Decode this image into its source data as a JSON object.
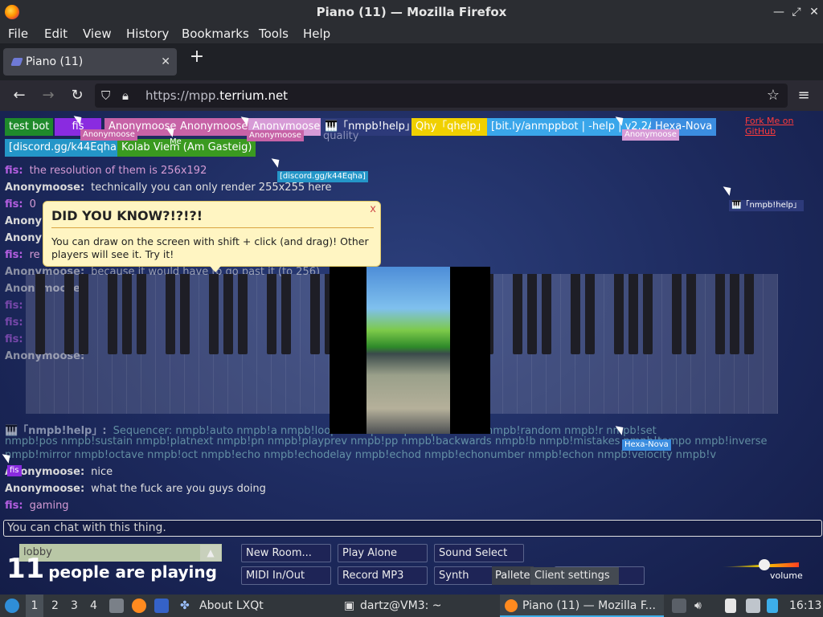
{
  "window": {
    "title": "Piano (11) — Mozilla Firefox"
  },
  "menu": [
    "File",
    "Edit",
    "View",
    "History",
    "Bookmarks",
    "Tools",
    "Help"
  ],
  "tab": {
    "label": "Piano (11)"
  },
  "nav": {
    "url_prefix": "https://mpp.",
    "url_domain": "terrium.net"
  },
  "page": {
    "users": [
      {
        "name": "test bot",
        "color": "#1f8a2b"
      },
      {
        "name": "fis",
        "color": "#8a2be0"
      },
      {
        "name": "Anonymoose",
        "color": "#c763a7"
      },
      {
        "name": "Anonymoose",
        "color": "#c763a7"
      },
      {
        "name": "Anonymoose",
        "color": "#d79bd7"
      },
      {
        "name": "🎹「nmpb!help」",
        "color": "#2d3a7a"
      },
      {
        "name": "Qhy「qhelp」",
        "color": "#f0d000"
      },
      {
        "name": "[bit.ly/anmppbot | -help | v2.2A]",
        "color": "#3aa6ea"
      },
      {
        "name": "Hexa-Nova",
        "color": "#3b8de0"
      },
      {
        "name": "[discord.gg/k44Eqha]",
        "color": "#2496c8"
      },
      {
        "name": "Kolab Viem (Am Gasteig)",
        "color": "#3a9a20"
      }
    ],
    "fork_link": "Fork Me on GitHub",
    "chat": [
      {
        "name": "fis:",
        "text": "the resolution of them is 256x192",
        "kind": "fis"
      },
      {
        "name": "Anonymoose:",
        "text": "technically you can only render 255x255 here",
        "kind": "anon"
      },
      {
        "name": "fis:",
        "text": "0",
        "kind": "fis"
      },
      {
        "name": "Anonymoose:",
        "text": "",
        "kind": "anon"
      },
      {
        "name": "Anonymoose:",
        "text": "",
        "kind": "anon"
      },
      {
        "name": "fis:",
        "text": "re",
        "kind": "fis"
      },
      {
        "name": "Anonymoose:",
        "text": "because it would have to go past it (to 256)",
        "kind": "anon"
      },
      {
        "name": "Anonymoose:",
        "text": "",
        "kind": "anon"
      },
      {
        "name": "fis:",
        "text": "",
        "kind": "fis"
      },
      {
        "name": "fis:",
        "text": "",
        "kind": "fis"
      },
      {
        "name": "fis:",
        "text": "",
        "kind": "fis"
      },
      {
        "name": "Anonymoose:",
        "text": "",
        "kind": "anon"
      }
    ],
    "bot_lines": [
      {
        "name": "🎹「nmpb!help」:",
        "text": "Sequencer: nmpb!auto nmpb!a nmpb!loop ... nmpb!stop nmpb!restart nmpb!random nmpb!r nmpb!set"
      },
      {
        "text": "nmpb!pos nmpb!sustain nmpb!platnext nmpb!pn nmpb!playprev nmpb!pp nmpb!backwards nmpb!b nmpb!mistakes nmpb!tempo nmpb!inverse"
      },
      {
        "text": "nmpb!mirror nmpb!octave nmpb!oct nmpb!echo nmpb!echodelay nmpb!echod nmpb!echonumber nmpb!echon nmpb!velocity nmpb!v"
      }
    ],
    "recent_chat": [
      {
        "name": "Anonymoose:",
        "text": "nice",
        "kind": "anon"
      },
      {
        "name": "Anonymoose:",
        "text": "what the fuck are you guys doing",
        "kind": "anon"
      },
      {
        "name": "fis:",
        "text": "gaming",
        "kind": "fis"
      }
    ],
    "partial_text": "quality",
    "tooltip": {
      "title": "DID YOU KNOW?!?!?!",
      "body": "You can draw on the screen with shift + click (and drag)! Other players will see it. Try it!",
      "close": "x"
    },
    "cursor_labels": {
      "anon1": "Anonymoose",
      "me": "Me",
      "anon2": "Anonymoose",
      "anon3": "Anonymoose",
      "discord": "[discord.gg/k44Eqha]",
      "nmpb": "🎹「nmpb!help」",
      "hexa": "Hexa-Nova",
      "fis": "fis"
    },
    "chat_placeholder": "You can chat with this thing.",
    "room": {
      "name": "lobby"
    },
    "count": "11",
    "count_label": "people are playing",
    "buttons": {
      "new_room": "New Room...",
      "play_alone": "Play Alone",
      "sound_select": "Sound Select",
      "midi": "MIDI In/Out",
      "record": "Record MP3",
      "synth": "Synth",
      "pallete": "Pallete",
      "client_settings": "Client settings"
    },
    "volume_label": "volume"
  },
  "taskbar": {
    "desktops": [
      "1",
      "2",
      "3",
      "4"
    ],
    "about": "About LXQt",
    "terminal": "dartz@VM3: ~",
    "firefox": "Piano (11) — Mozilla F...",
    "clock": "16:13"
  }
}
